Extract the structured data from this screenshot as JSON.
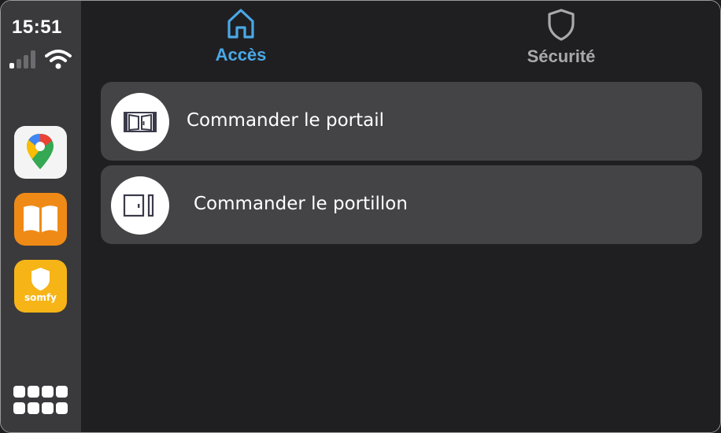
{
  "status_bar": {
    "time": "15:51",
    "signal_bars_active": 1,
    "signal_bars_total": 4
  },
  "dock": {
    "apps": [
      {
        "name": "maps-icon"
      },
      {
        "name": "books-icon"
      },
      {
        "name": "somfy-icon",
        "label": "somfy"
      }
    ],
    "grid_icon": "app-grid-icon"
  },
  "tabs": [
    {
      "label": "Accès",
      "icon": "home-icon",
      "active": true
    },
    {
      "label": "Sécurité",
      "icon": "shield-icon",
      "active": false
    }
  ],
  "actions": [
    {
      "label": "Commander le portail",
      "icon": "gate-icon"
    },
    {
      "label": "Commander le portillon",
      "icon": "wicket-door-icon"
    }
  ],
  "colors": {
    "accent": "#4aa8e6",
    "inactive_tab": "#a9a9ab",
    "row_background": "#444446",
    "sidebar_background": "#3a3a3c",
    "main_background": "#1f1f22"
  }
}
